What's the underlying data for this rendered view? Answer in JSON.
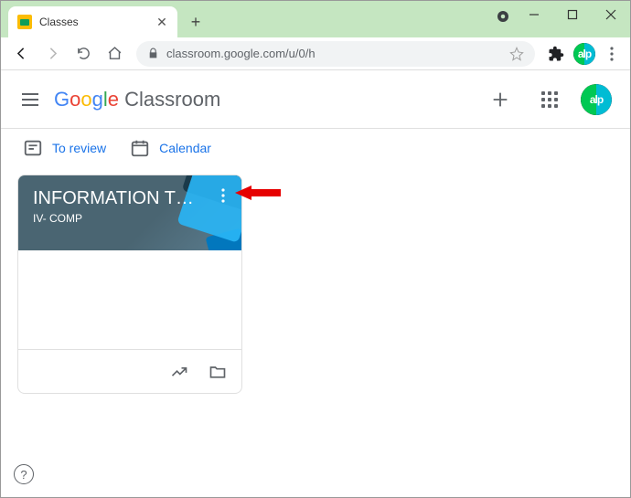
{
  "browser": {
    "tab_title": "Classes",
    "url": "classroom.google.com/u/0/h"
  },
  "header": {
    "logo_classroom": "Classroom",
    "avatar_text": "alp"
  },
  "subbar": {
    "to_review": "To review",
    "calendar": "Calendar"
  },
  "card": {
    "title": "INFORMATION TECH...",
    "subtitle": "IV- COMP"
  }
}
